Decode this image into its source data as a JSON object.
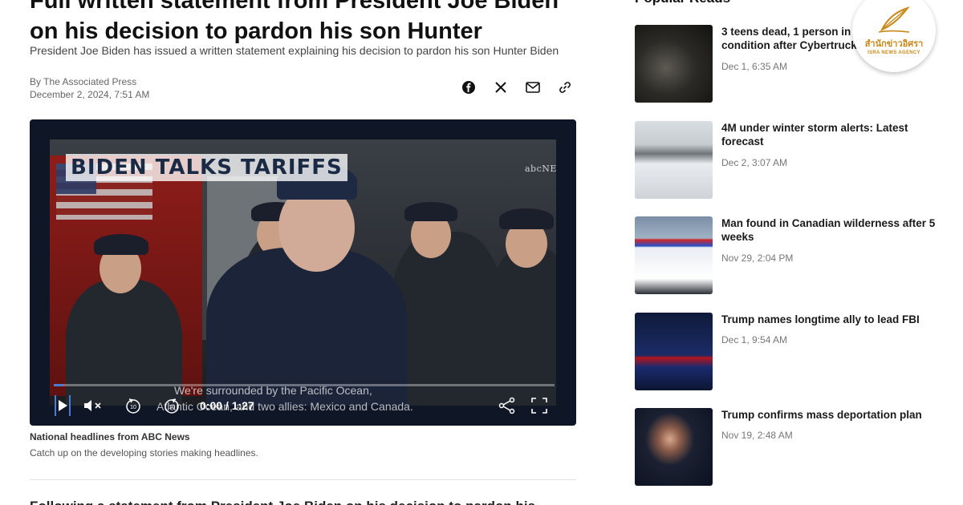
{
  "article": {
    "headline": "Full written statement from President Joe Biden on his decision to pardon his son Hunter",
    "subhead": "President Joe Biden has issued a written statement explaining his decision to pardon his son Hunter Biden",
    "byline": "By The Associated Press",
    "date": "December 2, 2024, 7:51 AM",
    "share_icons": [
      "facebook-icon",
      "x-icon",
      "mail-icon",
      "link-icon"
    ],
    "body_peek": "Following a statement from President Joe Biden on his decision to pardon his"
  },
  "video": {
    "banner": "BIDEN TALKS TARIFFS",
    "network_logo": "abcNEWS",
    "caption_line1": "We're surrounded by the Pacific Ocean,",
    "caption_line2": "Atlantic Ocean, and two allies: Mexico and Canada.",
    "time": "0:00 / 1:27",
    "progress": 0.02,
    "replay_back": "10",
    "skip_forward": "10",
    "accent_color": "#4a7bd8"
  },
  "video_caption": {
    "title": "National headlines from ABC News",
    "subtitle": "Catch up on the developing stories making headlines."
  },
  "sidebar": {
    "title": "Popular Reads",
    "items": [
      {
        "title": "3 teens dead, 1 person in critical condition after Cybertruck crash",
        "date": "Dec 1, 6:35 AM"
      },
      {
        "title": "4M under winter storm alerts: Latest forecast",
        "date": "Dec 2, 3:07 AM"
      },
      {
        "title": "Man found in Canadian wilderness after 5 weeks",
        "date": "Nov 29, 2:04 PM"
      },
      {
        "title": "Trump names longtime ally to lead FBI",
        "date": "Dec 1, 9:54 AM"
      },
      {
        "title": "Trump confirms mass deportation plan",
        "date": "Nov 19, 2:48 AM"
      }
    ]
  },
  "watermark": {
    "thai": "สำนักข่าวอิศรา",
    "english": "ISRA NEWS AGENCY"
  }
}
